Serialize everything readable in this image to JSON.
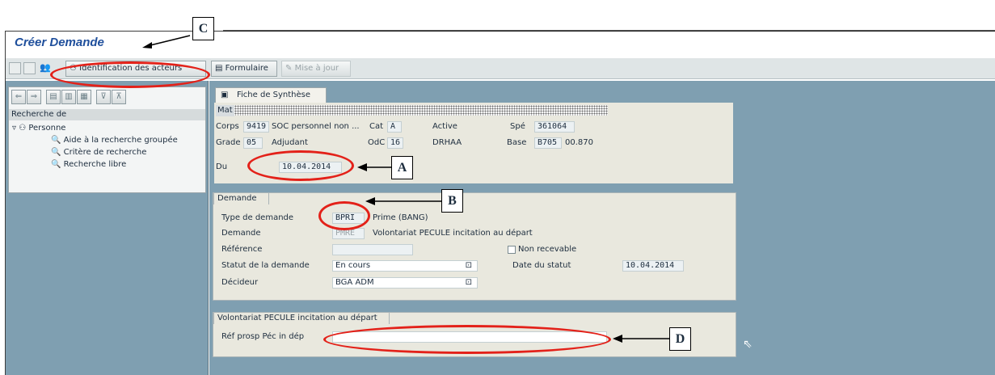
{
  "window": {
    "title": "Créer Demande"
  },
  "toolbar": {
    "identification_label": "Identification des acteurs",
    "formulaire_label": "Formulaire",
    "mise_a_jour_label": "Mise à jour"
  },
  "left_panel": {
    "recherche_label": "Recherche de",
    "tree_root": "Personne",
    "tree_items": [
      "Aide à la recherche groupée",
      "Critère de recherche",
      "Recherche libre"
    ]
  },
  "main": {
    "tab_label": "Fiche de Synthèse",
    "mat_label": "Mat",
    "header": {
      "corps_label": "Corps",
      "corps_value": "9419",
      "corps_text": "SOC personnel non ...",
      "cat_label": "Cat",
      "cat_value": "A",
      "active_text": "Active",
      "spe_label": "Spé",
      "spe_value": "361064",
      "grade_label": "Grade",
      "grade_value": "05",
      "grade_text": "Adjudant",
      "odc_label": "OdC",
      "odc_value": "16",
      "odc_text": "DRHAA",
      "base_label": "Base",
      "base_value": "B705",
      "base_text": "00.870",
      "du_label": "Du",
      "du_value": "10.04.2014"
    },
    "demande_group": {
      "title": "Demande",
      "type_label": "Type de demande",
      "type_value": "BPRI",
      "type_text": "Prime (BANG)",
      "demande_label": "Demande",
      "demande_value": "PMRE",
      "demande_text": "Volontariat PECULE incitation au départ",
      "reference_label": "Référence",
      "reference_value": "",
      "non_recevable_label": "Non recevable",
      "statut_label": "Statut de la demande",
      "statut_value": "En cours",
      "date_statut_label": "Date du statut",
      "date_statut_value": "10.04.2014",
      "decideur_label": "Décideur",
      "decideur_value": "BGA ADM"
    },
    "pecule_group": {
      "title": "Volontariat PECULE incitation au départ",
      "ref_label": "Réf prosp Péc in dép",
      "ref_value": ""
    }
  },
  "annotations": {
    "a": "A",
    "b": "B",
    "c": "C",
    "d": "D"
  },
  "colors": {
    "annotation_red": "#e32119",
    "panel_blue": "#7f9fb1",
    "title_blue": "#1f4f9c"
  }
}
